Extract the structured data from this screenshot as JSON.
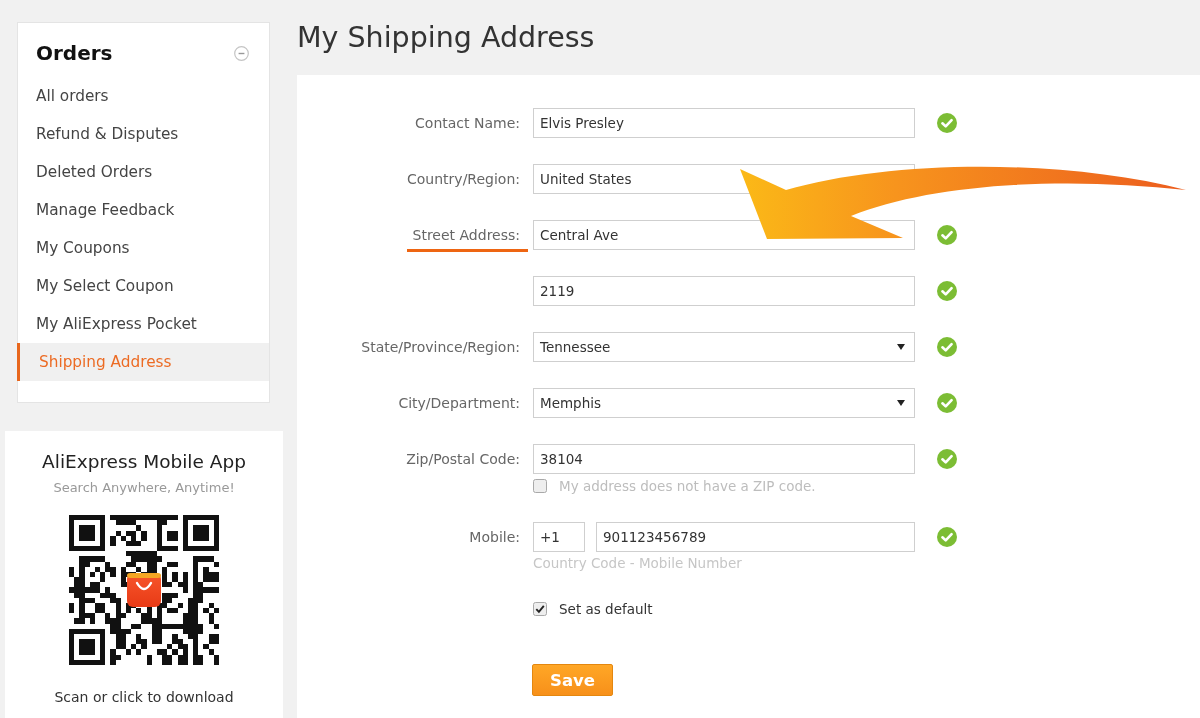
{
  "sidebar": {
    "title": "Orders",
    "expanded": true,
    "items": [
      {
        "label": "All orders",
        "selected": false
      },
      {
        "label": "Refund & Disputes",
        "selected": false
      },
      {
        "label": "Deleted Orders",
        "selected": false
      },
      {
        "label": "Manage Feedback",
        "selected": false
      },
      {
        "label": "My Coupons",
        "selected": false
      },
      {
        "label": "My Select Coupon",
        "selected": false
      },
      {
        "label": "My AliExpress Pocket",
        "selected": false
      },
      {
        "label": "Shipping Address",
        "selected": true
      }
    ]
  },
  "app_promo": {
    "title": "AliExpress Mobile App",
    "subtitle": "Search Anywhere, Anytime!",
    "caption": "Scan or click to download"
  },
  "page_title": "My Shipping Address",
  "form": {
    "rows": [
      {
        "kind": "text",
        "label": "Contact Name:",
        "value": "Elvis Presley",
        "valid": true,
        "highlighted": false
      },
      {
        "kind": "text",
        "label": "Country/Region:",
        "value": "United States",
        "highlighted": false
      },
      {
        "kind": "text",
        "label": "Street Address:",
        "value": "Central Ave",
        "valid": true,
        "highlighted": true
      },
      {
        "kind": "text",
        "value": "2119",
        "valid": true,
        "highlighted": false
      },
      {
        "kind": "select",
        "label": "State/Province/Region:",
        "value": "Tennessee",
        "valid": true,
        "highlighted": false
      },
      {
        "kind": "select",
        "label": "City/Department:",
        "value": "Memphis",
        "valid": true,
        "highlighted": false
      },
      {
        "kind": "text",
        "label": "Zip/Postal Code:",
        "value": "38104",
        "valid": true,
        "highlighted": false,
        "option": {
          "label": "My address does not have a ZIP code.",
          "checked": false
        }
      },
      {
        "kind": "phone",
        "label": "Mobile:",
        "code": "+1",
        "value": "901123456789",
        "valid": true,
        "highlighted": false,
        "hint": "Country Code - Mobile Number"
      }
    ],
    "default_option": {
      "label": "Set as default",
      "checked": true
    },
    "save_label": "Save"
  }
}
